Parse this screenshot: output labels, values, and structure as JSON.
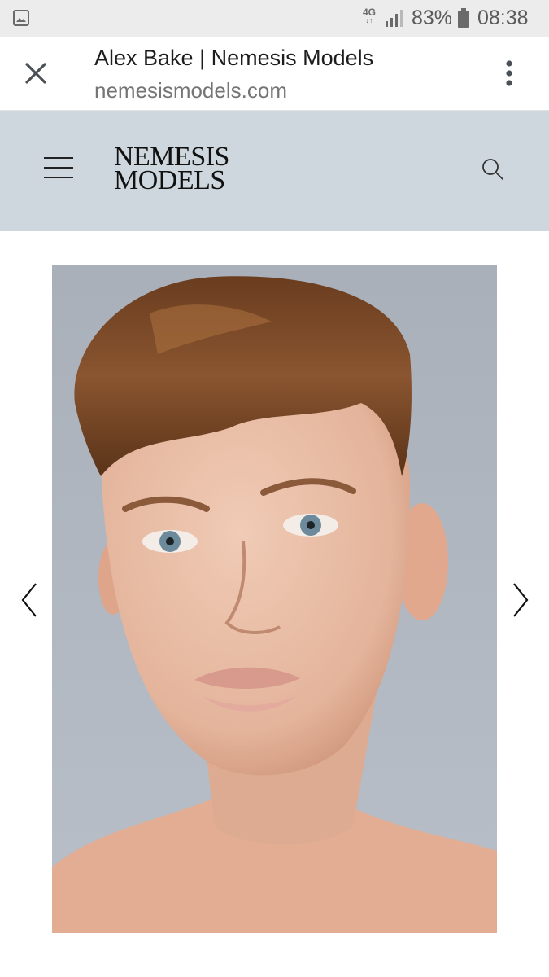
{
  "status_bar": {
    "network_type": "4G",
    "network_arrows": "↓↑",
    "battery_percent": "83%",
    "time": "08:38",
    "icons": [
      "gallery-notification-icon",
      "signal-icon",
      "battery-icon"
    ]
  },
  "browser": {
    "page_title": "Alex Bake | Nemesis Models",
    "domain": "nemesismodels.com",
    "icons": [
      "close-icon",
      "more-vert-icon"
    ]
  },
  "site": {
    "logo_line1": "NEMESIS",
    "logo_line2": "MODELS",
    "header_color": "#cdd7dd",
    "icons": [
      "hamburger-menu-icon",
      "search-icon"
    ]
  },
  "gallery": {
    "photo_subject": "Alex Bake",
    "icons": [
      "chevron-left-icon",
      "chevron-right-icon"
    ]
  }
}
